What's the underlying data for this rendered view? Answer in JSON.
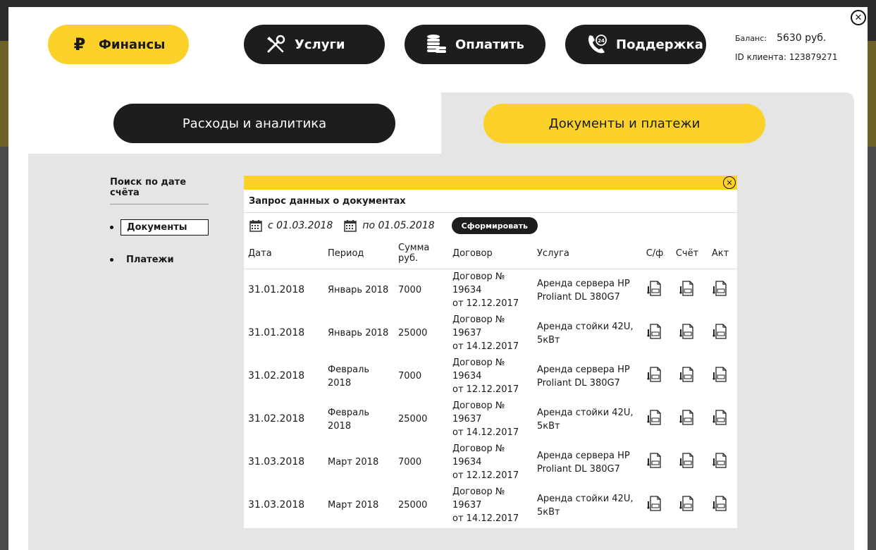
{
  "nav": [
    {
      "label": "Финансы",
      "icon": "ruble-icon"
    },
    {
      "label": "Услуги",
      "icon": "tools-icon"
    },
    {
      "label": "Оплатить",
      "icon": "coins-icon"
    },
    {
      "label": "Поддержка",
      "icon": "phone-24-icon"
    }
  ],
  "ruble_glyph": "₽",
  "account": {
    "balance_label": "Баланс:",
    "balance_value": "5630 руб.",
    "client_id": "ID клиента: 123879271"
  },
  "tabs": [
    {
      "label": "Расходы и аналитика"
    },
    {
      "label": "Документы и платежи"
    }
  ],
  "filter": {
    "title": "Поиск по дате счёта",
    "items": [
      {
        "label": "Документы",
        "active": true
      },
      {
        "label": "Платежи",
        "active": false
      }
    ]
  },
  "docs": {
    "title": "Запрос данных о документах",
    "date_from": "с 01.03.2018",
    "date_to": "по 01.05.2018",
    "generate_label": "Сформировать",
    "columns": [
      "Дата",
      "Период",
      "Сумма руб.",
      "Договор",
      "Услуга",
      "С/ф",
      "Счёт",
      "Акт"
    ],
    "rows": [
      {
        "date": "31.01.2018",
        "period": "Январь 2018",
        "sum": "7000",
        "contract_no": "Договор № 19634",
        "contract_date": "от 12.12.2017",
        "service": "Аренда сервера HP Proliant DL 380G7"
      },
      {
        "date": "31.01.2018",
        "period": "Январь 2018",
        "sum": "25000",
        "contract_no": "Договор № 19637",
        "contract_date": "от 14.12.2017",
        "service": "Аренда стойки 42U, 5кВт"
      },
      {
        "date": "31.02.2018",
        "period": "Февраль 2018",
        "sum": "7000",
        "contract_no": "Договор № 19634",
        "contract_date": "от 12.12.2017",
        "service": "Аренда сервера HP Proliant DL 380G7"
      },
      {
        "date": "31.02.2018",
        "period": "Февраль 2018",
        "sum": "25000",
        "contract_no": "Договор № 19637",
        "contract_date": "от 14.12.2017",
        "service": "Аренда стойки 42U, 5кВт"
      },
      {
        "date": "31.03.2018",
        "period": "Март 2018",
        "sum": "7000",
        "contract_no": "Договор № 19634",
        "contract_date": "от 12.12.2017",
        "service": "Аренда сервера HP Proliant DL 380G7"
      },
      {
        "date": "31.03.2018",
        "period": "Март 2018",
        "sum": "25000",
        "contract_no": "Договор № 19637",
        "contract_date": "от 14.12.2017",
        "service": "Аренда стойки 42U, 5кВт"
      }
    ]
  },
  "colors": {
    "accent_yellow": "#fcd12a",
    "dark": "#1d1d1b",
    "panel_grey": "#e5e5e5"
  },
  "icons": {
    "close": "close-icon",
    "calendar": "calendar-icon",
    "document": "pdf-download-icon"
  }
}
